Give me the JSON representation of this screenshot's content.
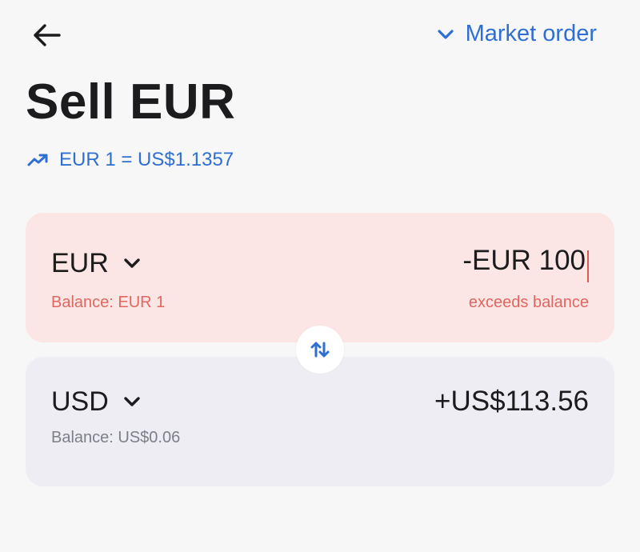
{
  "header": {
    "back_icon": "arrow-left-icon",
    "order_type_label": "Market order",
    "order_type_icon": "chevron-down-icon"
  },
  "title": "Sell EUR",
  "rate": {
    "icon": "trending-up-icon",
    "text": "EUR 1 = US$1.1357"
  },
  "sell_card": {
    "currency": "EUR",
    "amount": "-EUR 100",
    "balance": "Balance: EUR 1",
    "error": "exceeds balance"
  },
  "swap": {
    "icon": "swap-vertical-icon"
  },
  "buy_card": {
    "currency": "USD",
    "amount": "+US$113.56",
    "balance": "Balance: US$0.06"
  },
  "colors": {
    "accent": "#2f6fd3",
    "error": "#e0675f",
    "sell_bg": "#fbe5e5",
    "buy_bg": "#ededf3"
  }
}
